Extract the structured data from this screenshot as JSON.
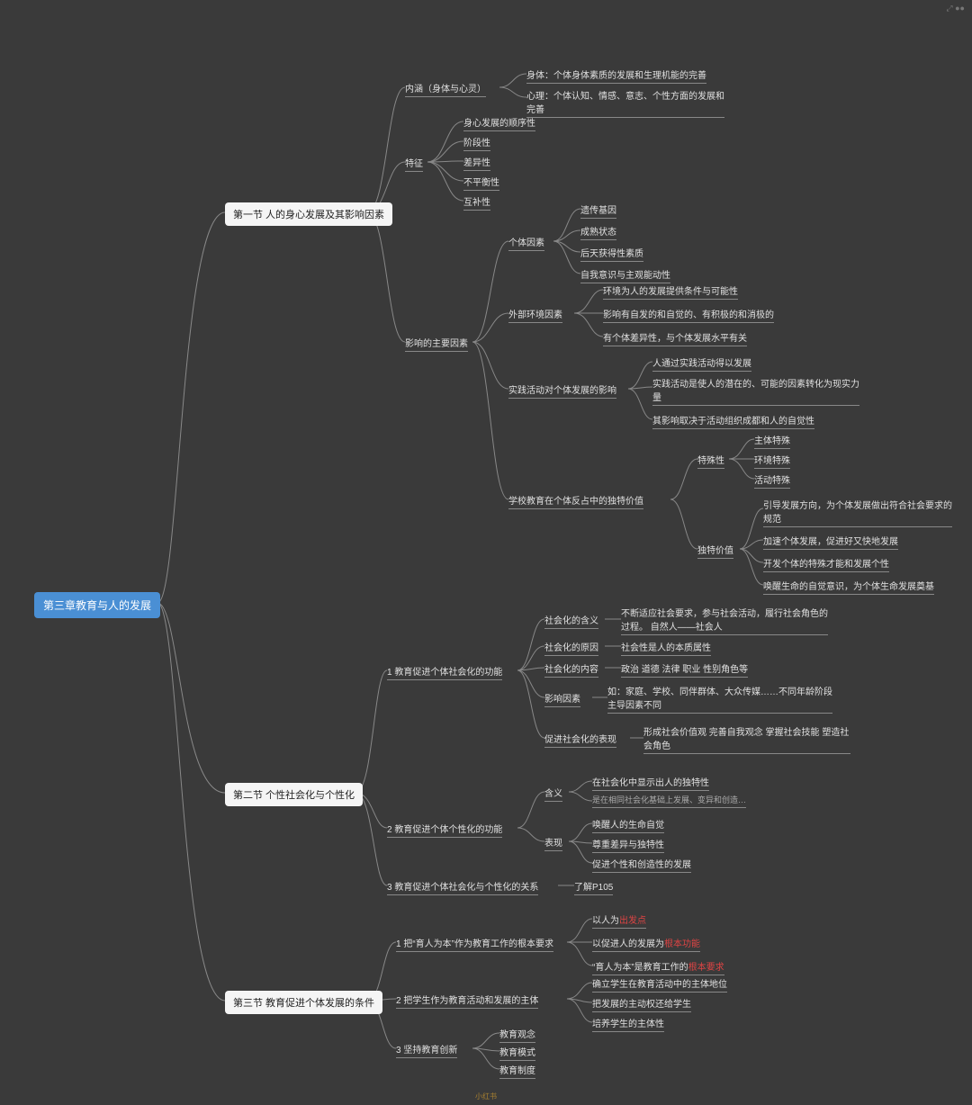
{
  "root": "第三章教育与人的发展",
  "s1": {
    "title": "第一节 人的身心发展及其影响因素",
    "b1": {
      "label": "内涵（身体与心灵）",
      "leaves": [
        "身体：个体身体素质的发展和生理机能的完善",
        "心理：个体认知、情感、意志、个性方面的发展和完善"
      ]
    },
    "b2": {
      "label": "特征",
      "leaves": [
        "身心发展的顺序性",
        "阶段性",
        "差异性",
        "不平衡性",
        "互补性"
      ]
    },
    "b3": {
      "label": "影响的主要因素",
      "c1": {
        "label": "个体因素",
        "leaves": [
          "遗传基因",
          "成熟状态",
          "后天获得性素质",
          "自我意识与主观能动性"
        ]
      },
      "c2": {
        "label": "外部环境因素",
        "leaves": [
          "环境为人的发展提供条件与可能性",
          "影响有自发的和自觉的、有积极的和消极的",
          "有个体差异性，与个体发展水平有关"
        ]
      },
      "c3": {
        "label": "实践活动对个体发展的影响",
        "leaves": [
          "人通过实践活动得以发展",
          "实践活动是使人的潜在的、可能的因素转化为现实力量",
          "其影响取决于活动组织成都和人的自觉性"
        ]
      },
      "c4": {
        "label": "学校教育在个体反占中的独特价值",
        "d1": {
          "label": "特殊性",
          "leaves": [
            "主体特殊",
            "环境特殊",
            "活动特殊"
          ]
        },
        "d2": {
          "label": "独特价值",
          "leaves": [
            "引导发展方向，为个体发展做出符合社会要求的规范",
            "加速个体发展，促进好又快地发展",
            "开发个体的特殊才能和发展个性",
            "唤醒生命的自觉意识，为个体生命发展奠基"
          ]
        }
      }
    }
  },
  "s2": {
    "title": "第二节 个性社会化与个性化",
    "b1": {
      "label": "1 教育促进个体社会化的功能",
      "c1": {
        "label": "社会化的含义",
        "note": "不断适应社会要求，参与社会活动，履行社会角色的过程。        自然人——社会人"
      },
      "c2": {
        "label": "社会化的原因",
        "note": "社会性是人的本质属性"
      },
      "c3": {
        "label": "社会化的内容",
        "note": "政治 道德 法律 职业 性别角色等"
      },
      "c4": {
        "label": "影响因素",
        "note": "如：家庭、学校、同伴群体、大众传媒……不同年龄阶段主导因素不同"
      },
      "c5": {
        "label": "促进社会化的表现",
        "note": "形成社会价值观 完善自我观念 掌握社会技能 塑造社会角色"
      }
    },
    "b2": {
      "label": "2 教育促进个体个性化的功能",
      "c1": {
        "label": "含义",
        "leaves": [
          "在社会化中显示出人的独特性",
          "是在相同社会化基础上发展、变异和创造…"
        ]
      },
      "c2": {
        "label": "表现",
        "leaves": [
          "唤醒人的生命自觉",
          "尊重差异与独特性",
          "促进个性和创造性的发展"
        ]
      }
    },
    "b3": {
      "label": "3 教育促进个体社会化与个性化的关系",
      "note": "了解P105"
    }
  },
  "s3": {
    "title": "第三节 教育促进个体发展的条件",
    "b1": {
      "label": "1 把“育人为本”作为教育工作的根本要求",
      "leaves": [
        {
          "pre": "以人为",
          "hl": "出发点"
        },
        {
          "pre": "以促进人的发展为",
          "hl": "根本功能"
        },
        {
          "pre": "“育人为本”是教育工作的",
          "hl": "根本要求"
        }
      ]
    },
    "b2": {
      "label": "2 把学生作为教育活动和发展的主体",
      "leaves": [
        "确立学生在教育活动中的主体地位",
        "把发展的主动权还给学生",
        "培养学生的主体性"
      ]
    },
    "b3": {
      "label": "3 坚持教育创新",
      "leaves": [
        "教育观念",
        "教育模式",
        "教育制度"
      ]
    }
  },
  "footer": "小红书",
  "corner": "⤢ ●●"
}
